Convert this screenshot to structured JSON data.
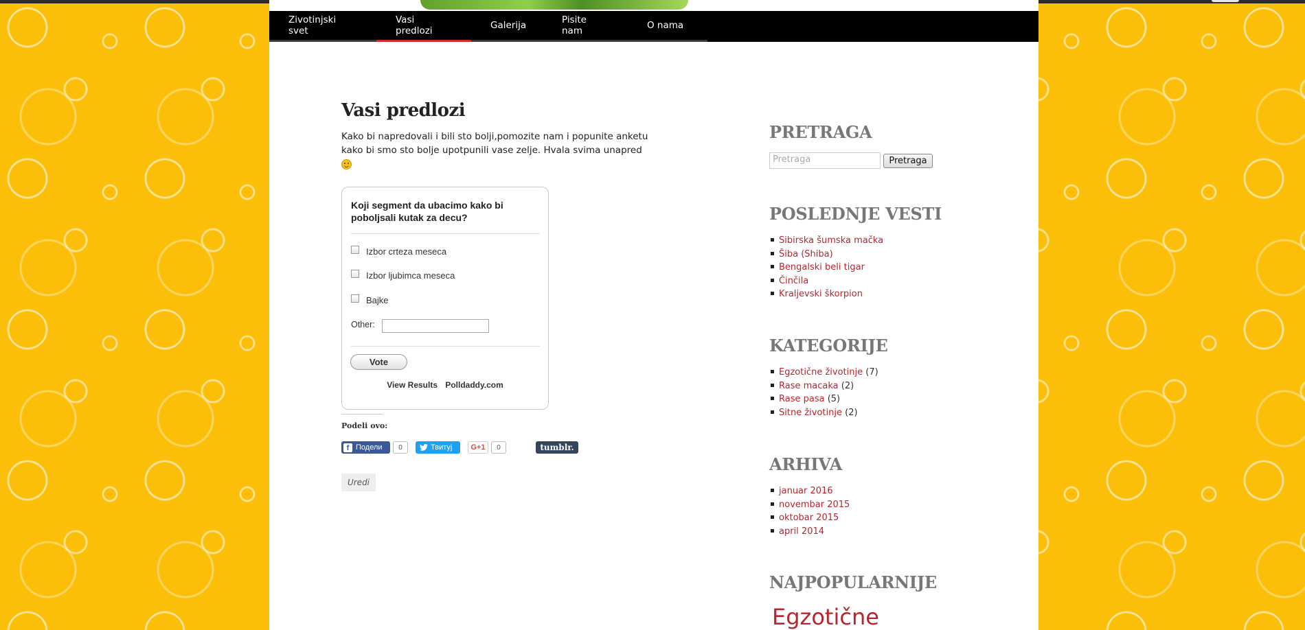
{
  "nav": {
    "items": [
      {
        "label": "Zivotinjski svet"
      },
      {
        "label": "Vasi predlozi",
        "active": true
      },
      {
        "label": "Galerija"
      },
      {
        "label": "Pisite nam"
      },
      {
        "label": "O nama"
      }
    ]
  },
  "page": {
    "title": "Vasi predlozi",
    "intro": "Kako bi napredovali i bili sto bolji,pomozite nam i popunite anketu kako bi smo sto bolje upotpunili vase zelje. Hvala svima unapred"
  },
  "poll": {
    "question": "Koji segment da ubacimo kako bi poboljsali kutak za decu?",
    "options": [
      {
        "label": "Izbor crteza meseca"
      },
      {
        "label": "Izbor ljubimca meseca"
      },
      {
        "label": "Bajke"
      }
    ],
    "other_label": "Other:",
    "vote_label": "Vote",
    "view_results": "View Results",
    "brand": "Polldaddy.com"
  },
  "share": {
    "label": "Podeli ovo:",
    "facebook": "Подели",
    "facebook_count": "0",
    "twitter": "Твитуј",
    "gplus": "G+1",
    "gplus_count": "0",
    "tumblr": "tumblr."
  },
  "edit_label": "Uredi",
  "sidebar": {
    "search": {
      "title": "PRETRAGA",
      "placeholder": "Pretraga",
      "button": "Pretraga"
    },
    "recent": {
      "title": "POSLEDNJE VESTI",
      "items": [
        "Sibirska šumska mačka",
        "Šiba (Shiba)",
        "Bengalski beli tigar",
        "Činčila",
        "Kraljevski škorpion"
      ]
    },
    "categories": {
      "title": "KATEGORIJE",
      "items": [
        {
          "name": "Egzotične životinje",
          "count": "(7)"
        },
        {
          "name": "Rase macaka",
          "count": "(2)"
        },
        {
          "name": "Rase pasa",
          "count": "(5)"
        },
        {
          "name": "Sitne životinje",
          "count": "(2)"
        }
      ]
    },
    "archive": {
      "title": "ARHIVA",
      "items": [
        "januar 2016",
        "novembar 2015",
        "oktobar 2015",
        "april 2014"
      ]
    },
    "popular": {
      "title": "NAJPOPULARNIJE",
      "first": "Egzotične"
    }
  },
  "colors": {
    "background": "#fbbf0a",
    "link": "#b8252f",
    "nav_active": "#d22a2a",
    "widget_title": "#777777"
  }
}
